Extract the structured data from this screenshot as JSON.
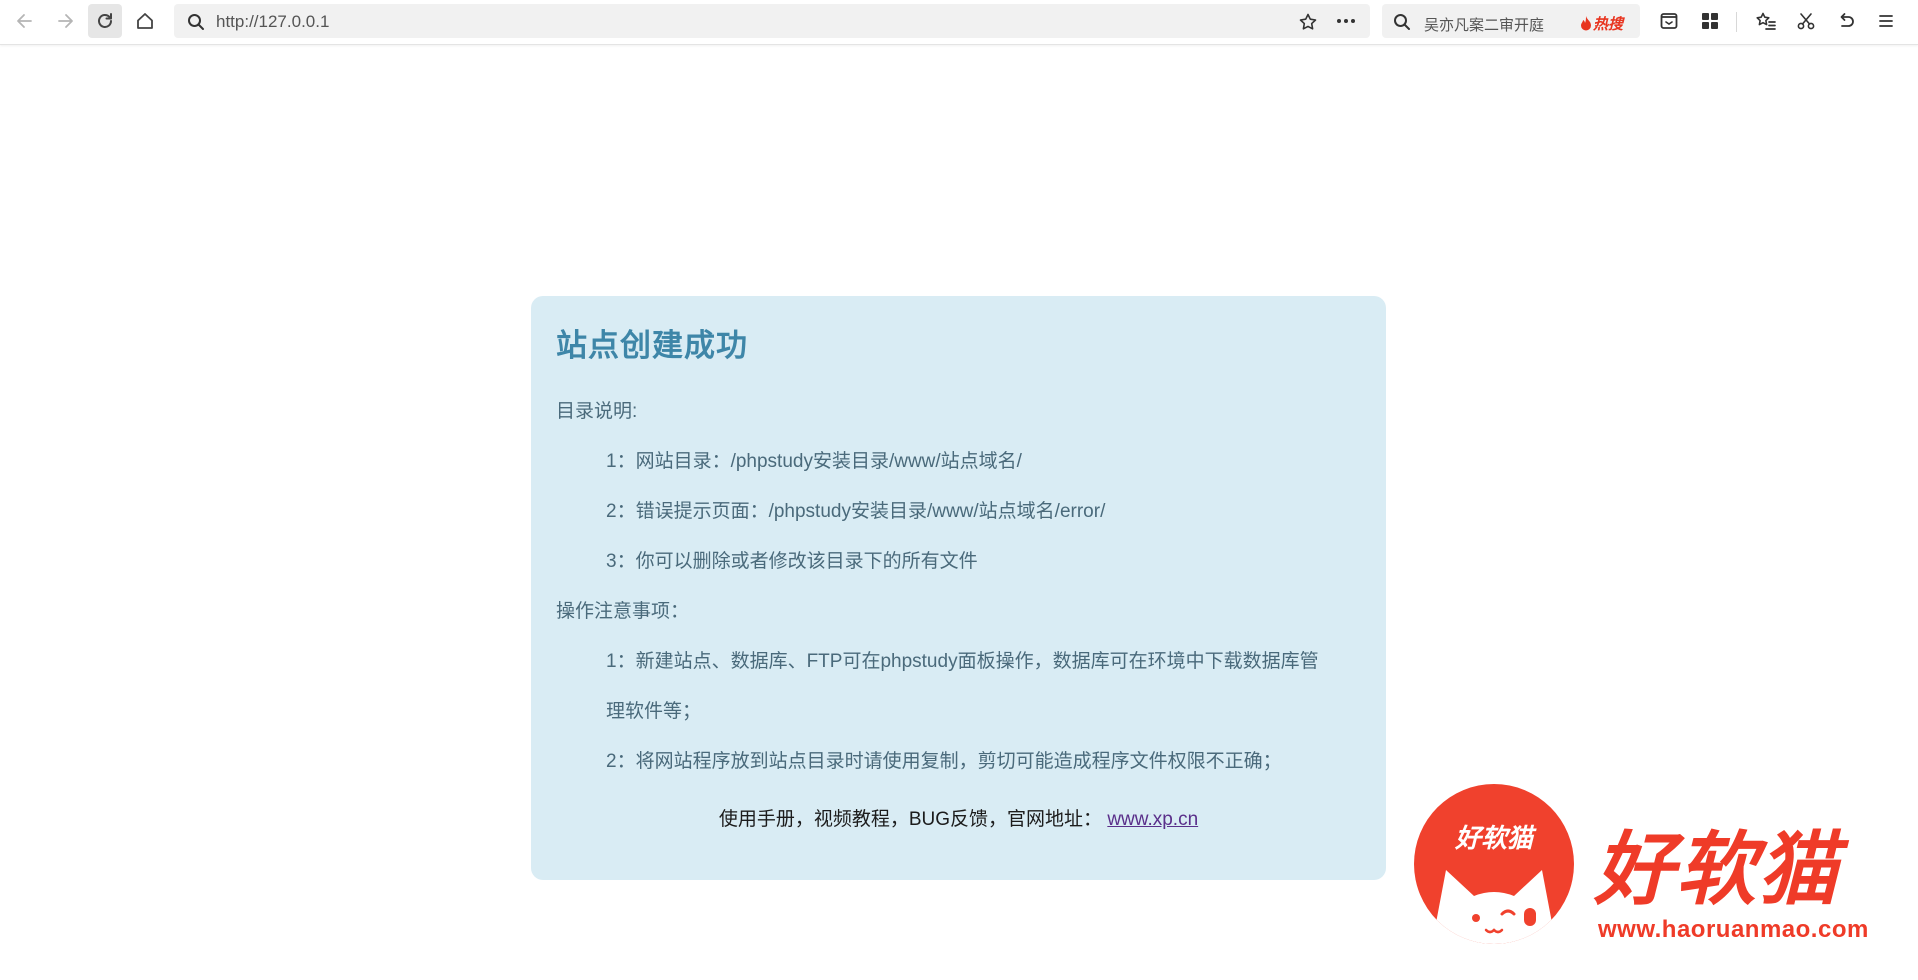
{
  "browser": {
    "url": "http://127.0.0.1",
    "hot_search": {
      "query": "吴亦凡案二审开庭",
      "badge": "热搜"
    },
    "icons": {
      "back": "arrow-left-icon",
      "forward": "arrow-right-icon",
      "reload": "reload-icon",
      "home": "home-icon",
      "search": "search-icon",
      "bookmark": "star-icon",
      "more": "more-dots-icon",
      "reader": "reader-icon",
      "apps": "grid-icon",
      "favorites": "star-list-icon",
      "screenshot": "scissors-icon",
      "undo": "undo-icon",
      "menu": "hamburger-menu-icon"
    }
  },
  "page": {
    "title": "站点创建成功",
    "sections": [
      {
        "heading": "目录说明:",
        "items": [
          "1：网站目录：/phpstudy安装目录/www/站点域名/",
          "2：错误提示页面：/phpstudy安装目录/www/站点域名/error/",
          "3：你可以删除或者修改该目录下的所有文件"
        ]
      },
      {
        "heading": "操作注意事项：",
        "items": [
          "1：新建站点、数据库、FTP可在phpstudy面板操作，数据库可在环境中下载数据库管",
          "理软件等；",
          "2：将网站程序放到站点目录时请使用复制，剪切可能造成程序文件权限不正确；"
        ]
      }
    ],
    "footer_text": "使用手册，视频教程，BUG反馈，官网地址：",
    "footer_link": "www.xp.cn"
  },
  "watermark": {
    "badge_text": "好软猫",
    "brand": "好软猫",
    "url": "www.haoruanmao.com"
  },
  "colors": {
    "card_bg": "#d9ecf4",
    "title": "#3e86a8",
    "body_text": "#4a6a7b",
    "link": "#5a2f8a",
    "watermark_red": "#ef3b28",
    "hot_badge": "#e8341f"
  }
}
